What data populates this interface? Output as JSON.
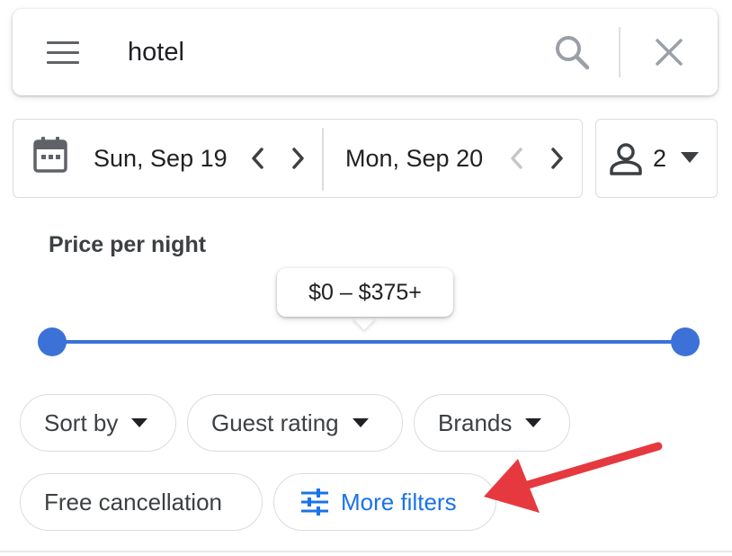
{
  "search": {
    "query": "hotel",
    "menu_icon": "menu-icon",
    "search_icon": "search-icon",
    "clear_icon": "close-icon"
  },
  "dates": {
    "checkin": "Sun, Sep 19",
    "checkout": "Mon, Sep 20",
    "calendar_icon": "calendar-icon"
  },
  "guests": {
    "count": "2",
    "icon": "person-icon"
  },
  "price": {
    "label": "Price per night",
    "range": "$0 – $375+",
    "min_fraction": 0,
    "max_fraction": 1
  },
  "filters": {
    "sort_by": "Sort by",
    "guest_rating": "Guest rating",
    "brands": "Brands",
    "free_cancellation": "Free cancellation",
    "more_filters": "More filters"
  },
  "colors": {
    "accent": "#3c72d8",
    "link": "#1a73e8",
    "annotation": "#e5393f",
    "border": "#dadce0"
  }
}
